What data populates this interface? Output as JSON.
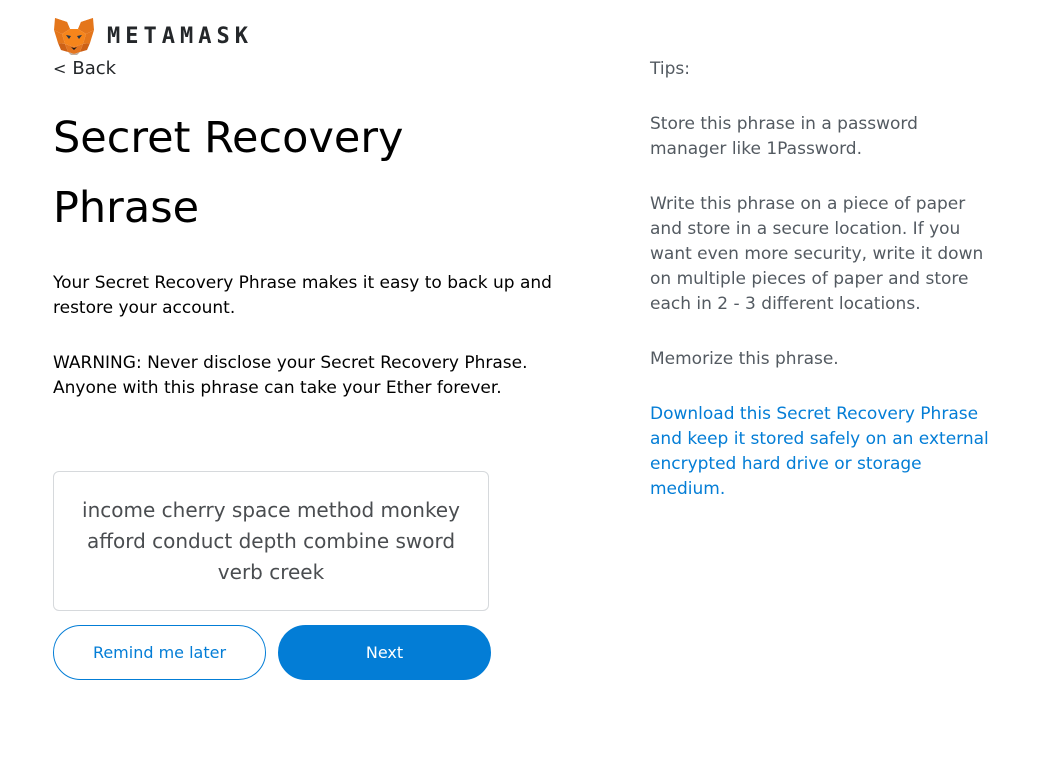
{
  "header": {
    "brand": "METAMASK",
    "logo_icon": "metamask-fox-icon"
  },
  "nav": {
    "back_label": "Back",
    "back_icon": "chevron-left-icon"
  },
  "main": {
    "title": "Secret Recovery Phrase",
    "intro": "Your Secret Recovery Phrase makes it easy to back up and restore your account.",
    "warning": "WARNING: Never disclose your Secret Recovery Phrase. Anyone with this phrase can take your Ether forever.",
    "phrase": "income cherry space method monkey afford conduct depth combine sword verb creek",
    "remind_label": "Remind me later",
    "next_label": "Next"
  },
  "tips": {
    "title": "Tips:",
    "items": [
      "Store this phrase in a password manager like 1Password.",
      "Write this phrase on a piece of paper and store in a secure location. If you want even more security, write it down on multiple pieces of paper and store each in 2 - 3 different locations.",
      "Memorize this phrase."
    ],
    "download_link": "Download this Secret Recovery Phrase and keep it stored safely on an external encrypted hard drive or storage medium."
  },
  "colors": {
    "accent": "#037dd6",
    "text": "#24272a",
    "muted": "#535a61",
    "border": "#d6d9dc"
  }
}
